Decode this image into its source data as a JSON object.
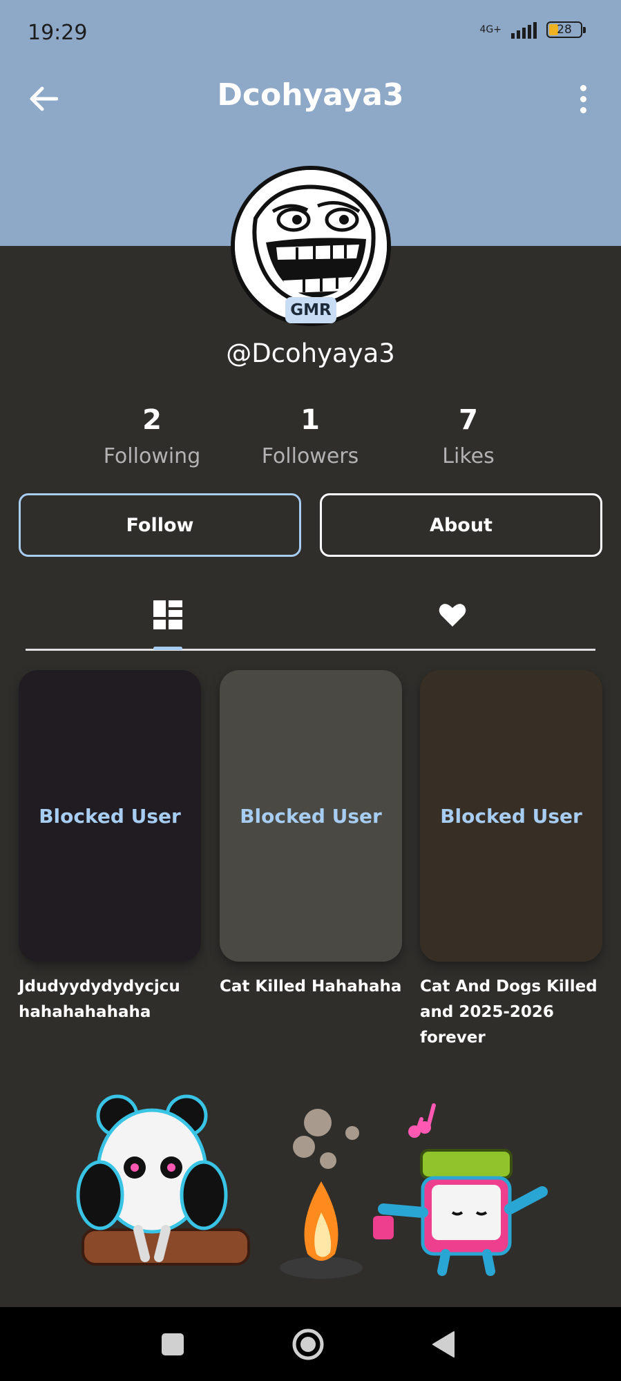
{
  "status_bar": {
    "time": "19:29",
    "network": "4G+",
    "battery": "28"
  },
  "top_bar": {
    "title": "Dcohyaya3"
  },
  "profile": {
    "badge": "GMR",
    "handle": "@Dcohyaya3"
  },
  "stats": [
    {
      "value": "2",
      "label": "Following"
    },
    {
      "value": "1",
      "label": "Followers"
    },
    {
      "value": "7",
      "label": "Likes"
    }
  ],
  "actions": {
    "follow_label": "Follow",
    "about_label": "About"
  },
  "tabs": [
    {
      "icon": "grid-layout-icon",
      "selected": true
    },
    {
      "icon": "heart-icon",
      "selected": false
    }
  ],
  "videos": [
    {
      "overlay": "Blocked User",
      "caption": "Jdudyydydydycjcu hahahahahaha",
      "color": "#211c22"
    },
    {
      "overlay": "Blocked User",
      "caption": "Cat Killed Hahahaha",
      "color": "#4a4944"
    },
    {
      "overlay": "Blocked User",
      "caption": "Cat And Dogs Killed and 2025-2026 forever",
      "color": "#372e26"
    }
  ],
  "colors": {
    "header": "#8ea8c8",
    "background": "#2f2e2b",
    "accent": "#a8cdf2"
  }
}
